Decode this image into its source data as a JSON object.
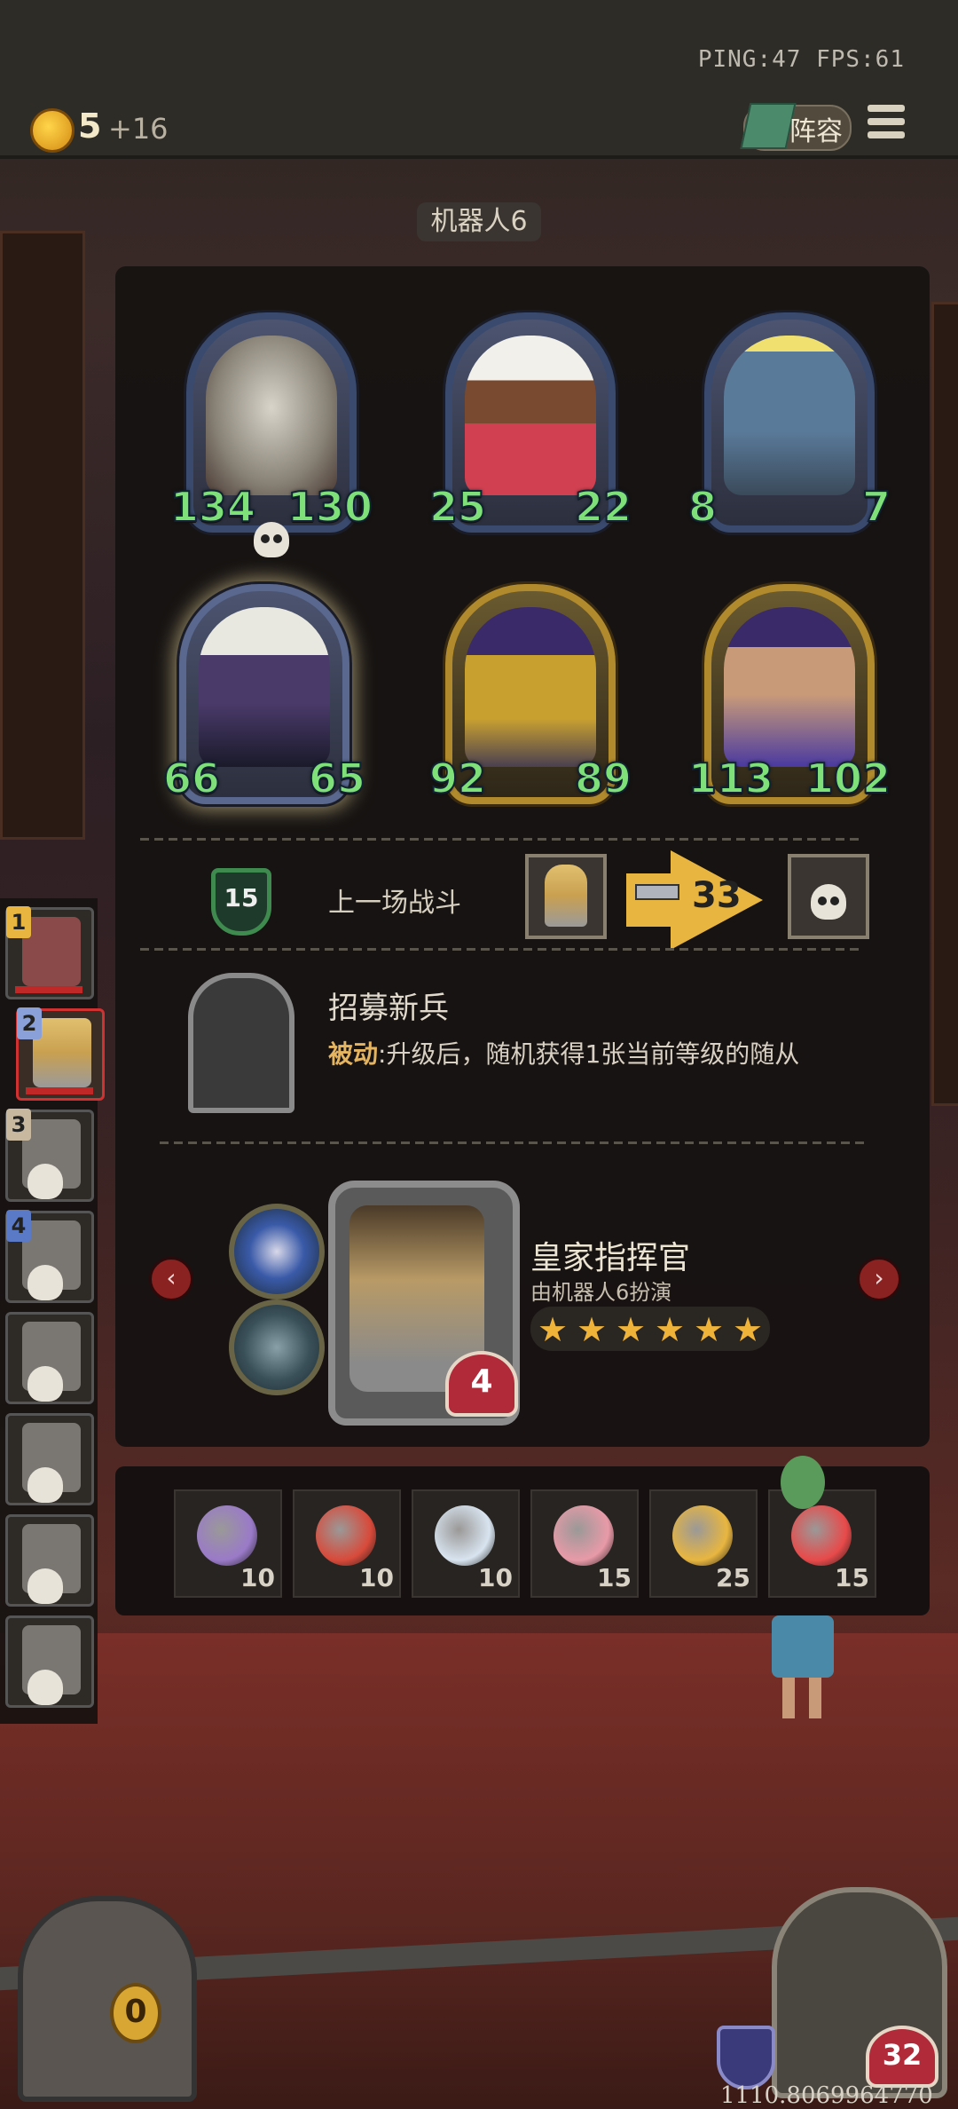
{
  "top_bar": {
    "ping_fps": "PING:47  FPS:61",
    "gold": "5",
    "gold_income": "+16",
    "lineup_label": "阵容"
  },
  "board": {
    "title": "机器人6",
    "minions": [
      {
        "attack": "134",
        "health": "130",
        "frame": "blue",
        "has_skull": true,
        "art": "egg"
      },
      {
        "attack": "25",
        "health": "22",
        "frame": "blue",
        "has_skull": false,
        "art": "chef"
      },
      {
        "attack": "8",
        "health": "7",
        "frame": "blue",
        "has_skull": false,
        "art": "robot"
      },
      {
        "attack": "66",
        "health": "65",
        "frame": "blue-glow",
        "has_skull": false,
        "art": "wizard"
      },
      {
        "attack": "92",
        "health": "89",
        "frame": "gold",
        "has_skull": false,
        "art": "golden-bot"
      },
      {
        "attack": "113",
        "health": "102",
        "frame": "gold",
        "has_skull": false,
        "art": "sorceress"
      }
    ]
  },
  "last_battle": {
    "tier": "15",
    "label": "上一场战斗",
    "damage": "33"
  },
  "hero_power": {
    "title": "招募新兵",
    "desc_prefix": "被动",
    "desc_rest": ":升级后，随机获得1张当前等级的随从"
  },
  "hero": {
    "name": "皇家指挥官",
    "played_by": "由机器人6扮演",
    "health": "4",
    "stars": 6,
    "prev_icon": "chevron-left-icon",
    "next_icon": "chevron-right-icon"
  },
  "items": [
    {
      "icon": "mirror-icon",
      "qty": "10",
      "color": "#9a7ac8"
    },
    {
      "icon": "alarm-clock-icon",
      "qty": "10",
      "color": "#d84a3a"
    },
    {
      "icon": "teacup-icon",
      "qty": "10",
      "color": "#d8e4f0"
    },
    {
      "icon": "cupcake-icon",
      "qty": "15",
      "color": "#e89aa8"
    },
    {
      "icon": "chicken-icon",
      "qty": "25",
      "color": "#e8b640"
    },
    {
      "icon": "clown-icon",
      "qty": "15",
      "color": "#e84a4a"
    }
  ],
  "players": [
    {
      "rank": "1",
      "selected": false,
      "eliminated": false
    },
    {
      "rank": "2",
      "selected": true,
      "eliminated": false
    },
    {
      "rank": "3",
      "selected": false,
      "eliminated": true
    },
    {
      "rank": "4",
      "selected": false,
      "eliminated": true
    },
    {
      "rank": "",
      "selected": false,
      "eliminated": true
    },
    {
      "rank": "",
      "selected": false,
      "eliminated": true
    },
    {
      "rank": "",
      "selected": false,
      "eliminated": true
    },
    {
      "rank": "",
      "selected": false,
      "eliminated": true
    }
  ],
  "bottom": {
    "chest_count": "0",
    "player_health": "32",
    "coordinate": "1110.8069964770"
  }
}
